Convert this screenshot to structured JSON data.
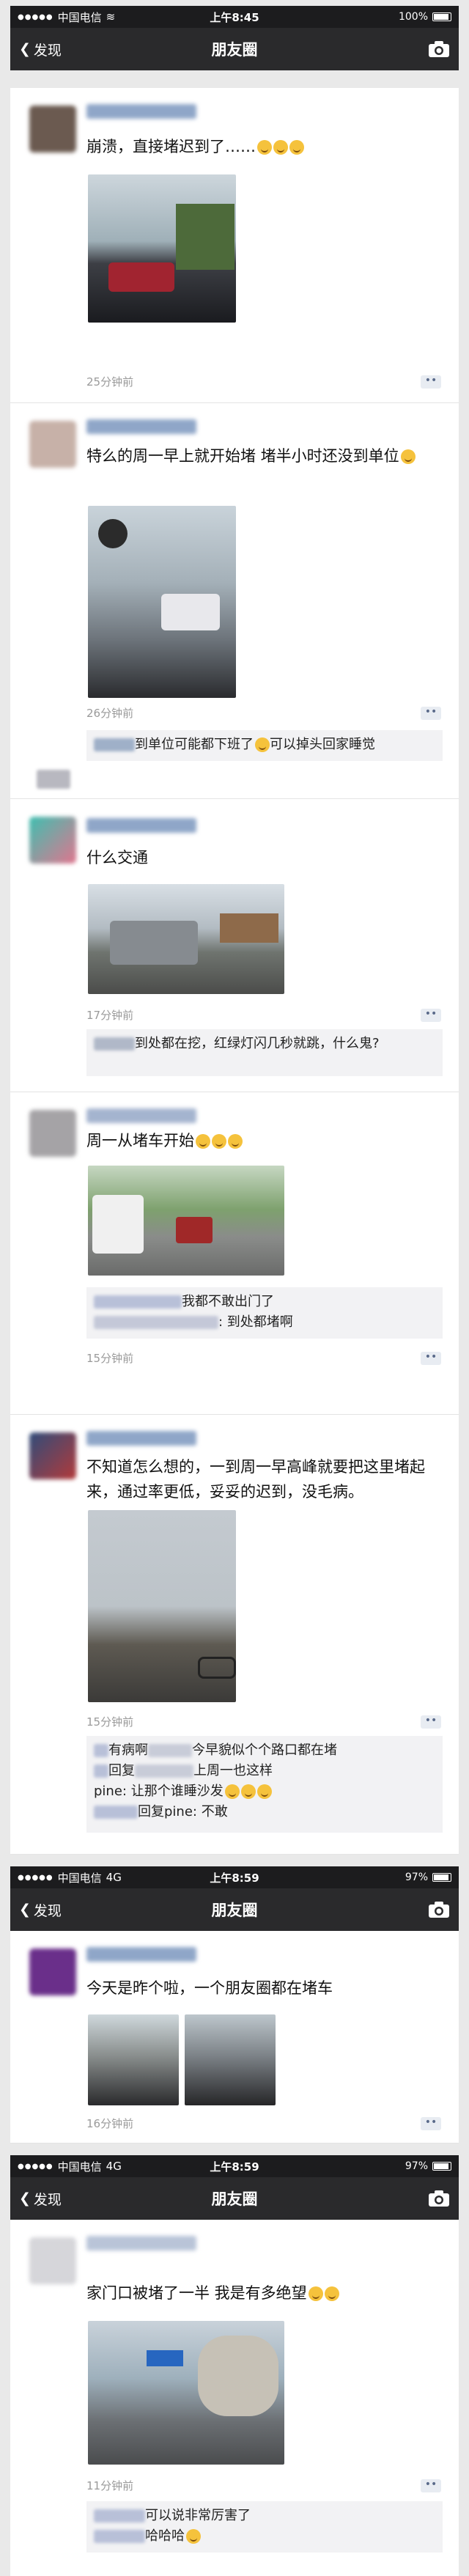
{
  "screens": [
    {
      "carrier": "中国电信",
      "network": "",
      "time": "上午8:45",
      "battery": "100%",
      "back": "发现",
      "title": "朋友圈"
    },
    {
      "carrier": "中国电信",
      "network": "4G",
      "time": "上午8:59",
      "battery": "97%",
      "back": "发现",
      "title": "朋友圈"
    },
    {
      "carrier": "中国电信",
      "network": "4G",
      "time": "上午8:59",
      "battery": "97%",
      "back": "发现",
      "title": "朋友圈"
    }
  ],
  "posts": [
    {
      "text": "崩溃，直接堵迟到了……",
      "time": "25分钟前",
      "comments": []
    },
    {
      "text": "特么的周一早上就开始堵 堵半小时还没到单位",
      "time": "26分钟前",
      "comments": [
        "到单位可能都下班了",
        "可以掉头回家睡觉"
      ]
    },
    {
      "text": "什么交通",
      "time": "17分钟前",
      "comments": [
        "到处都在挖，红绿灯闪几秒就跳，什么鬼?"
      ]
    },
    {
      "text": "周一从堵车开始",
      "time": "15分钟前",
      "comments": [
        "我都不敢出门了",
        ": 到处都堵啊"
      ]
    },
    {
      "text": "不知道怎么想的，一到周一早高峰就要把这里堵起来，通过率更低，妥妥的迟到，没毛病。",
      "time": "15分钟前",
      "comments": [
        "有病啊",
        "今早貌似个个路口都在堵",
        "回复",
        "上周一也这样",
        "pine: 让那个谁睡沙发",
        "回复pine: 不敢"
      ]
    },
    {
      "text": "今天是昨个啦，一个朋友圈都在堵车",
      "time": "16分钟前",
      "comments": []
    },
    {
      "text": "家门口被堵了一半 我是有多绝望",
      "time": "11分钟前",
      "comments": [
        "可以说非常厉害了",
        "哈哈哈"
      ]
    }
  ],
  "icons": {
    "back": "chevron-left-icon",
    "camera": "camera-icon",
    "more": "comment-more-icon",
    "battery": "battery-icon"
  },
  "colors": {
    "nav_bg": "#2a2a2c",
    "status_bg": "#1c1c1e",
    "link": "#576b95",
    "time": "#9a9a9a"
  }
}
